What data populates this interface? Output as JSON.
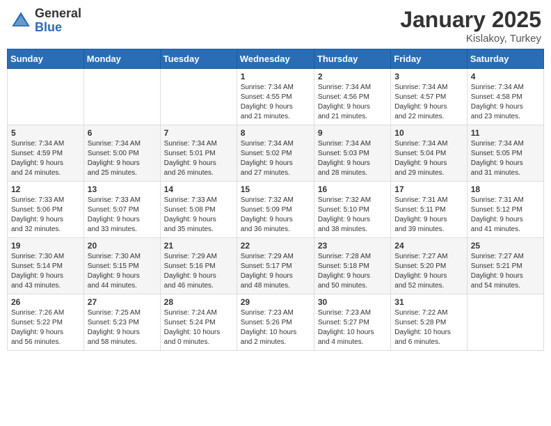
{
  "header": {
    "logo_general": "General",
    "logo_blue": "Blue",
    "month_title": "January 2025",
    "location": "Kislakoy, Turkey"
  },
  "weekdays": [
    "Sunday",
    "Monday",
    "Tuesday",
    "Wednesday",
    "Thursday",
    "Friday",
    "Saturday"
  ],
  "weeks": [
    [
      {
        "day": "",
        "info": ""
      },
      {
        "day": "",
        "info": ""
      },
      {
        "day": "",
        "info": ""
      },
      {
        "day": "1",
        "info": "Sunrise: 7:34 AM\nSunset: 4:55 PM\nDaylight: 9 hours\nand 21 minutes."
      },
      {
        "day": "2",
        "info": "Sunrise: 7:34 AM\nSunset: 4:56 PM\nDaylight: 9 hours\nand 21 minutes."
      },
      {
        "day": "3",
        "info": "Sunrise: 7:34 AM\nSunset: 4:57 PM\nDaylight: 9 hours\nand 22 minutes."
      },
      {
        "day": "4",
        "info": "Sunrise: 7:34 AM\nSunset: 4:58 PM\nDaylight: 9 hours\nand 23 minutes."
      }
    ],
    [
      {
        "day": "5",
        "info": "Sunrise: 7:34 AM\nSunset: 4:59 PM\nDaylight: 9 hours\nand 24 minutes."
      },
      {
        "day": "6",
        "info": "Sunrise: 7:34 AM\nSunset: 5:00 PM\nDaylight: 9 hours\nand 25 minutes."
      },
      {
        "day": "7",
        "info": "Sunrise: 7:34 AM\nSunset: 5:01 PM\nDaylight: 9 hours\nand 26 minutes."
      },
      {
        "day": "8",
        "info": "Sunrise: 7:34 AM\nSunset: 5:02 PM\nDaylight: 9 hours\nand 27 minutes."
      },
      {
        "day": "9",
        "info": "Sunrise: 7:34 AM\nSunset: 5:03 PM\nDaylight: 9 hours\nand 28 minutes."
      },
      {
        "day": "10",
        "info": "Sunrise: 7:34 AM\nSunset: 5:04 PM\nDaylight: 9 hours\nand 29 minutes."
      },
      {
        "day": "11",
        "info": "Sunrise: 7:34 AM\nSunset: 5:05 PM\nDaylight: 9 hours\nand 31 minutes."
      }
    ],
    [
      {
        "day": "12",
        "info": "Sunrise: 7:33 AM\nSunset: 5:06 PM\nDaylight: 9 hours\nand 32 minutes."
      },
      {
        "day": "13",
        "info": "Sunrise: 7:33 AM\nSunset: 5:07 PM\nDaylight: 9 hours\nand 33 minutes."
      },
      {
        "day": "14",
        "info": "Sunrise: 7:33 AM\nSunset: 5:08 PM\nDaylight: 9 hours\nand 35 minutes."
      },
      {
        "day": "15",
        "info": "Sunrise: 7:32 AM\nSunset: 5:09 PM\nDaylight: 9 hours\nand 36 minutes."
      },
      {
        "day": "16",
        "info": "Sunrise: 7:32 AM\nSunset: 5:10 PM\nDaylight: 9 hours\nand 38 minutes."
      },
      {
        "day": "17",
        "info": "Sunrise: 7:31 AM\nSunset: 5:11 PM\nDaylight: 9 hours\nand 39 minutes."
      },
      {
        "day": "18",
        "info": "Sunrise: 7:31 AM\nSunset: 5:12 PM\nDaylight: 9 hours\nand 41 minutes."
      }
    ],
    [
      {
        "day": "19",
        "info": "Sunrise: 7:30 AM\nSunset: 5:14 PM\nDaylight: 9 hours\nand 43 minutes."
      },
      {
        "day": "20",
        "info": "Sunrise: 7:30 AM\nSunset: 5:15 PM\nDaylight: 9 hours\nand 44 minutes."
      },
      {
        "day": "21",
        "info": "Sunrise: 7:29 AM\nSunset: 5:16 PM\nDaylight: 9 hours\nand 46 minutes."
      },
      {
        "day": "22",
        "info": "Sunrise: 7:29 AM\nSunset: 5:17 PM\nDaylight: 9 hours\nand 48 minutes."
      },
      {
        "day": "23",
        "info": "Sunrise: 7:28 AM\nSunset: 5:18 PM\nDaylight: 9 hours\nand 50 minutes."
      },
      {
        "day": "24",
        "info": "Sunrise: 7:27 AM\nSunset: 5:20 PM\nDaylight: 9 hours\nand 52 minutes."
      },
      {
        "day": "25",
        "info": "Sunrise: 7:27 AM\nSunset: 5:21 PM\nDaylight: 9 hours\nand 54 minutes."
      }
    ],
    [
      {
        "day": "26",
        "info": "Sunrise: 7:26 AM\nSunset: 5:22 PM\nDaylight: 9 hours\nand 56 minutes."
      },
      {
        "day": "27",
        "info": "Sunrise: 7:25 AM\nSunset: 5:23 PM\nDaylight: 9 hours\nand 58 minutes."
      },
      {
        "day": "28",
        "info": "Sunrise: 7:24 AM\nSunset: 5:24 PM\nDaylight: 10 hours\nand 0 minutes."
      },
      {
        "day": "29",
        "info": "Sunrise: 7:23 AM\nSunset: 5:26 PM\nDaylight: 10 hours\nand 2 minutes."
      },
      {
        "day": "30",
        "info": "Sunrise: 7:23 AM\nSunset: 5:27 PM\nDaylight: 10 hours\nand 4 minutes."
      },
      {
        "day": "31",
        "info": "Sunrise: 7:22 AM\nSunset: 5:28 PM\nDaylight: 10 hours\nand 6 minutes."
      },
      {
        "day": "",
        "info": ""
      }
    ]
  ]
}
